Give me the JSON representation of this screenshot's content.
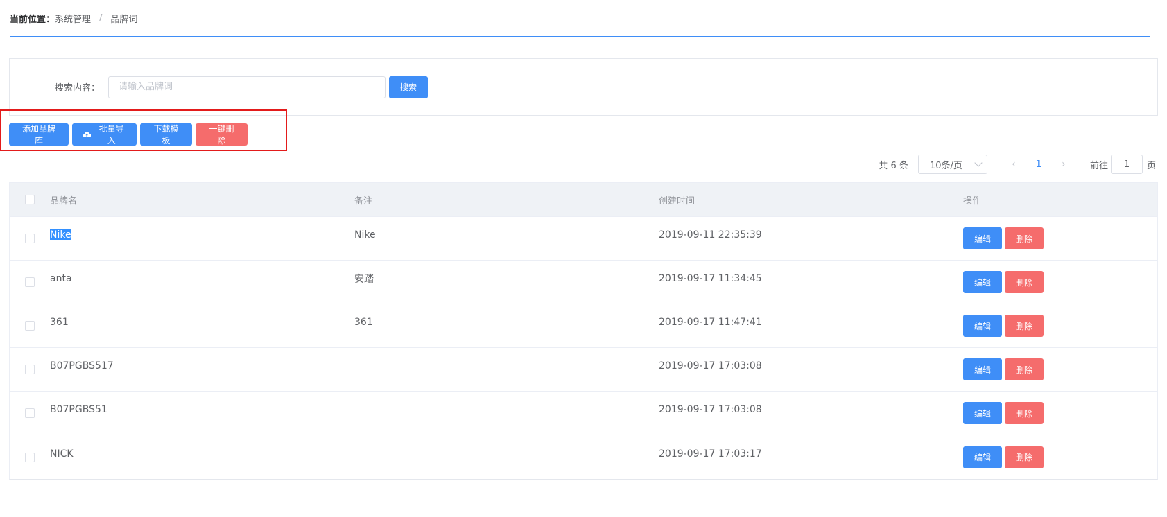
{
  "breadcrumb": {
    "label": "当前位置：",
    "section": "系统管理",
    "separator": "/",
    "page": "品牌词"
  },
  "search": {
    "label": "搜索内容：",
    "placeholder": "请输入品牌词",
    "value": "",
    "button": "搜索"
  },
  "toolbar": {
    "add": "添加品牌库",
    "import": "批量导入",
    "download": "下载模板",
    "delete_all": "一键删除"
  },
  "pagination": {
    "total": "共 6 条",
    "page_size": "10条/页",
    "prev": "‹",
    "current_page": "1",
    "next": "›",
    "goto_label": "前往",
    "goto_value": "1",
    "goto_suffix": "页"
  },
  "table": {
    "headers": {
      "name": "品牌名",
      "remark": "备注",
      "created": "创建时间",
      "ops": "操作"
    },
    "rows": [
      {
        "name": "Nike",
        "remark": "Nike",
        "created": "2019-09-11 22:35:39",
        "edit": "编辑",
        "delete": "删除"
      },
      {
        "name": "anta",
        "remark": "安踏",
        "created": "2019-09-17 11:34:45",
        "edit": "编辑",
        "delete": "删除"
      },
      {
        "name": "361",
        "remark": "361",
        "created": "2019-09-17 11:47:41",
        "edit": "编辑",
        "delete": "删除"
      },
      {
        "name": "B07PGBS517",
        "remark": "",
        "created": "2019-09-17 17:03:08",
        "edit": "编辑",
        "delete": "删除"
      },
      {
        "name": "B07PGBS51",
        "remark": "",
        "created": "2019-09-17 17:03:08",
        "edit": "编辑",
        "delete": "删除"
      },
      {
        "name": "NICK",
        "remark": "",
        "created": "2019-09-17 17:03:17",
        "edit": "编辑",
        "delete": "删除"
      }
    ]
  },
  "colors": {
    "primary": "#3f8ef7",
    "danger": "#f56c6c",
    "highlight_box": "#e31b1b",
    "header_bg": "#eff2f6"
  },
  "icons": {
    "import": "cloud-upload-icon"
  }
}
